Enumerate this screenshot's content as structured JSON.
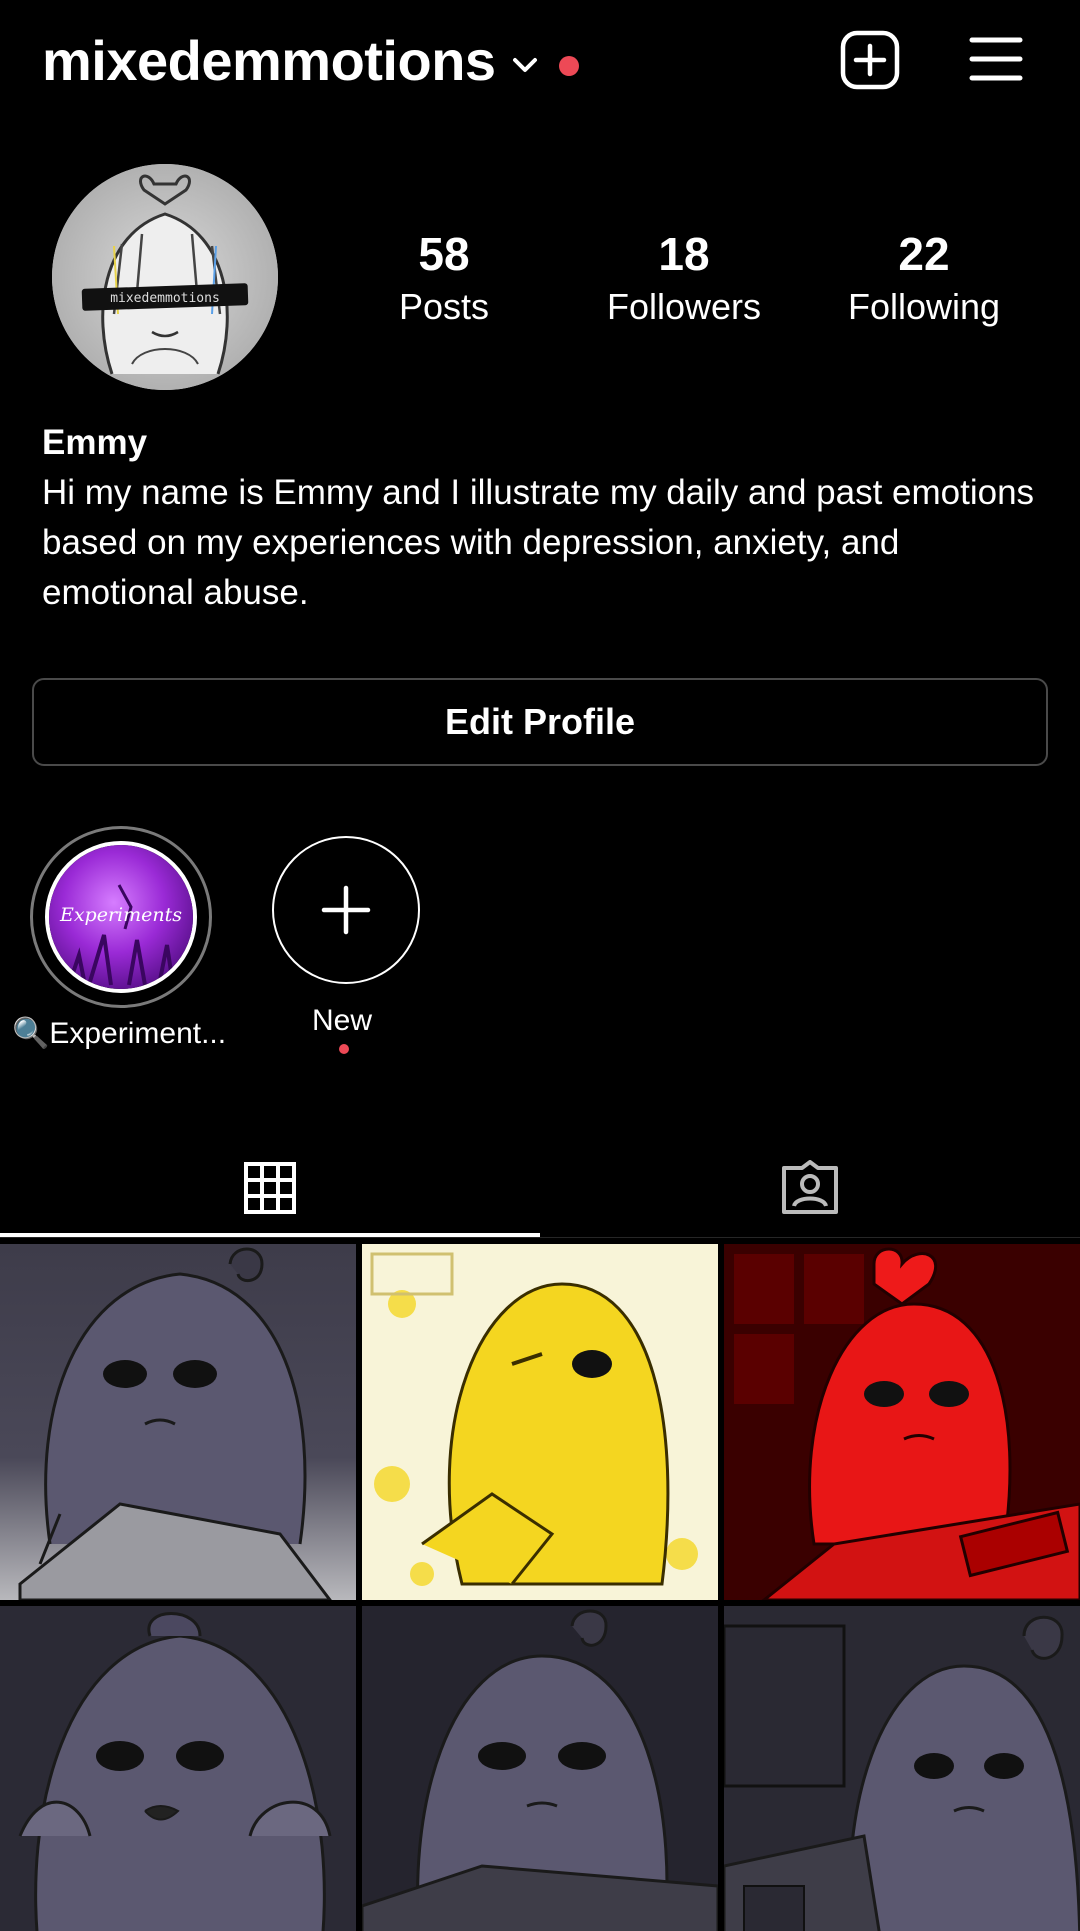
{
  "header": {
    "username": "mixedemmotions",
    "icons": [
      "chevron-down-icon",
      "notification-dot",
      "add-post-icon",
      "menu-icon"
    ]
  },
  "profile": {
    "avatar_label": "mixedemmotions",
    "stats": [
      {
        "value": "58",
        "label": "Posts"
      },
      {
        "value": "18",
        "label": "Followers"
      },
      {
        "value": "22",
        "label": "Following"
      }
    ],
    "name": "Emmy",
    "bio": "Hi my name is Emmy and I illustrate my daily and past emotions based on my experiences with depression, anxiety, and emotional abuse.",
    "edit_button": "Edit Profile"
  },
  "highlights": [
    {
      "cover_text": "Experiments",
      "label": "🔍Experiment..."
    },
    {
      "label": "New"
    }
  ],
  "tabs": [
    {
      "icon": "grid-icon",
      "active": true
    },
    {
      "icon": "tagged-icon",
      "active": false
    }
  ],
  "posts": [
    {
      "tint": "gray"
    },
    {
      "tint": "yellow"
    },
    {
      "tint": "red"
    },
    {
      "tint": "gray"
    },
    {
      "tint": "gray"
    },
    {
      "tint": "gray"
    }
  ],
  "colors": {
    "background": "#000000",
    "notification": "#ed4956",
    "border": "#4a4a4a"
  }
}
